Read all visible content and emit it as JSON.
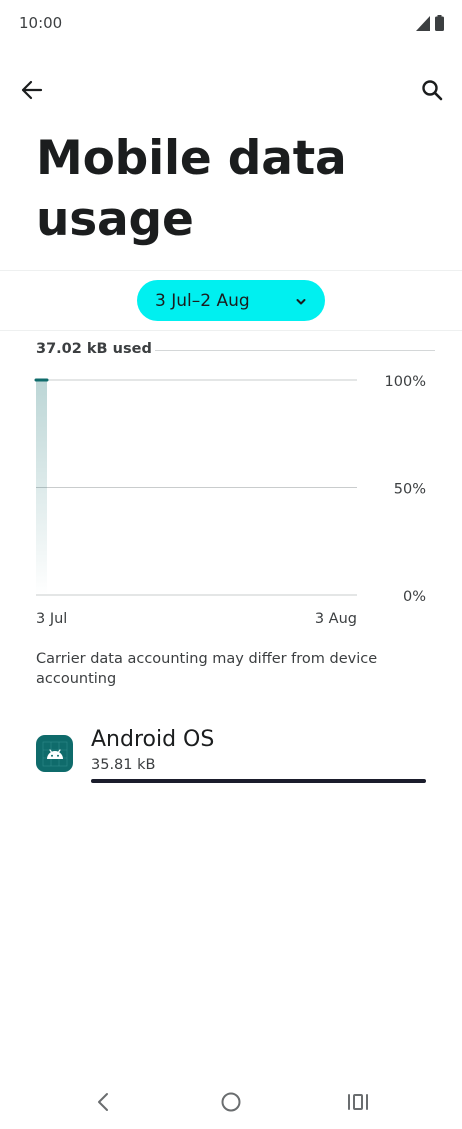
{
  "status_bar": {
    "time": "10:00",
    "icons": [
      "signal-icon",
      "battery-icon"
    ]
  },
  "top_bar": {
    "back_icon": "arrow-left-icon",
    "search_icon": "search-icon"
  },
  "page": {
    "title": "Mobile data usage"
  },
  "date_range": {
    "label": "3 Jul–2 Aug",
    "icon": "chevron-down-icon"
  },
  "usage": {
    "summary": "37.02 kB used"
  },
  "chart_data": {
    "type": "area",
    "x_start_label": "3 Jul",
    "x_end_label": "3 Aug",
    "y_ticks": [
      "100%",
      "50%",
      "0%"
    ],
    "ylim": [
      0,
      100
    ],
    "points": [
      {
        "x": "3 Jul",
        "y": 100
      }
    ],
    "grid": true,
    "colors": {
      "fill": "#0f6b6b",
      "gridline": "#c9cccd"
    }
  },
  "carrier_note": "Carrier data accounting may differ from device accounting",
  "apps": [
    {
      "name": "Android OS",
      "usage": "35.81 kB",
      "share": 1.0,
      "icon": "android-icon"
    }
  ],
  "nav_bar": {
    "icons": [
      "nav-back-icon",
      "nav-home-icon",
      "nav-recents-icon"
    ]
  },
  "colors": {
    "accent": "#00f0f0",
    "app_icon_bg": "#0f6b6b",
    "progress_fill": "#1b1d2c"
  }
}
